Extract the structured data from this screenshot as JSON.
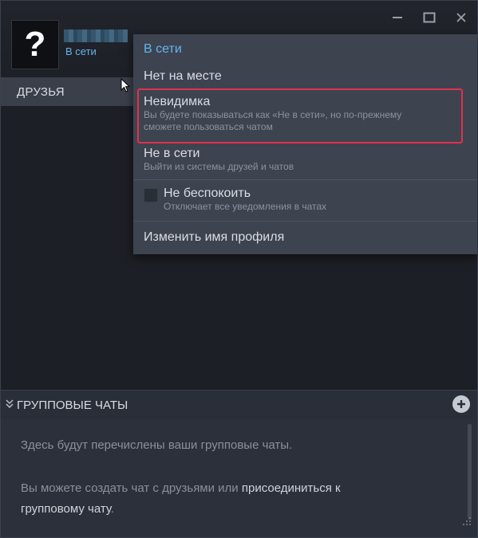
{
  "header": {
    "avatar_glyph": "?",
    "status": "В сети"
  },
  "window": {
    "minimize": "minimize-icon",
    "maximize": "maximize-icon",
    "close": "close-icon"
  },
  "friends": {
    "label": "ДРУЗЬЯ"
  },
  "status_menu": {
    "online": "В сети",
    "away": "Нет на месте",
    "invisible": {
      "title": "Невидимка",
      "subtitle_line1": "Вы будете показываться как «Не в сети», но по-прежнему",
      "subtitle_line2": "сможете пользоваться чатом"
    },
    "offline": {
      "title": "Не в сети",
      "subtitle": "Выйти из системы друзей и чатов"
    },
    "dnd": {
      "title": "Не беспокоить",
      "subtitle": "Отключает все уведомления в чатах",
      "checked": false
    },
    "rename": "Изменить имя профиля",
    "highlight_color": "#e0324d"
  },
  "group_chats": {
    "label": "ГРУППОВЫЕ ЧАТЫ",
    "empty_text": "Здесь будут перечислены ваши групповые чаты.",
    "create_prefix": "Вы можете создать чат с друзьями или ",
    "join_link_part1": "присоединиться к",
    "join_link_part2": "групповому чату",
    "create_suffix": "."
  },
  "colors": {
    "accent_blue": "#5fb7ef",
    "menu_bg": "#3e4350",
    "highlight": "#e0324d"
  }
}
